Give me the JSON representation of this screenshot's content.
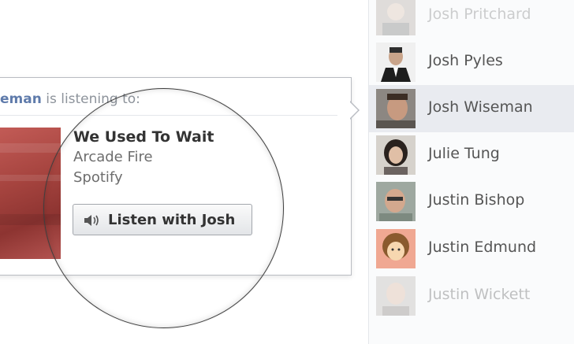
{
  "popover": {
    "user_name": "eman",
    "listening_text": "is listening to:",
    "track": {
      "title": "We Used To Wait",
      "artist": "Arcade Fire",
      "source": "Spotify"
    },
    "listen_button_label": "Listen with Josh"
  },
  "sidebar": {
    "friends": [
      {
        "name": "Josh Pritchard",
        "state": "faded"
      },
      {
        "name": "Josh Pyles",
        "state": "normal"
      },
      {
        "name": "Josh Wiseman",
        "state": "selected"
      },
      {
        "name": "Julie Tung",
        "state": "normal"
      },
      {
        "name": "Justin Bishop",
        "state": "normal"
      },
      {
        "name": "Justin Edmund",
        "state": "normal"
      },
      {
        "name": "Justin Wickett",
        "state": "faded"
      }
    ]
  },
  "colors": {
    "name_link": "#5f7bab",
    "muted_text": "#8d939b",
    "selected_row": "#e9ebf0",
    "album_red": "#a6443f"
  },
  "icons": {
    "listen_button": "speaker-icon"
  }
}
